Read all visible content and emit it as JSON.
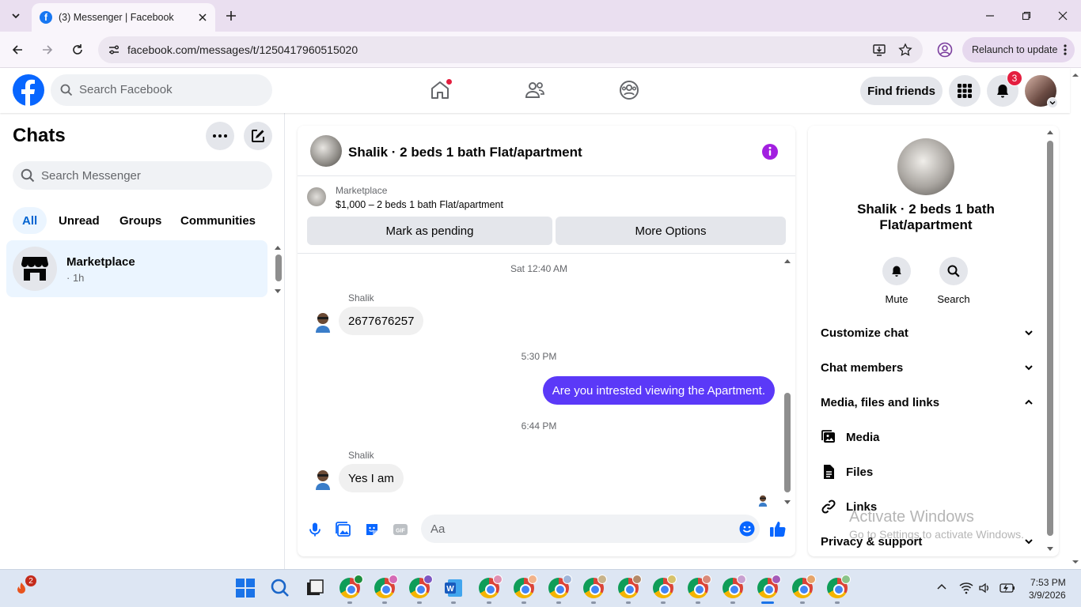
{
  "browser": {
    "tab_title": "(3) Messenger | Facebook",
    "url": "facebook.com/messages/t/1250417960515020",
    "relaunch_label": "Relaunch to update"
  },
  "fb_header": {
    "search_placeholder": "Search Facebook",
    "find_friends_label": "Find friends",
    "notification_count": "3",
    "brand_color": "#0866ff"
  },
  "sidebar": {
    "title": "Chats",
    "search_placeholder": "Search Messenger",
    "filters": [
      "All",
      "Unread",
      "Groups",
      "Communities"
    ],
    "active_filter": "All",
    "chats": [
      {
        "name": "Marketplace",
        "meta": "· 1h"
      }
    ]
  },
  "conversation": {
    "title": "Shalik · 2 beds 1 bath Flat/apartment",
    "marketplace": {
      "label": "Marketplace",
      "listing": "$1,000 – 2 beds 1 bath Flat/apartment",
      "mark_pending_label": "Mark as pending",
      "more_options_label": "More Options"
    },
    "messages": [
      {
        "timestamp": "Sat 12:40 AM"
      },
      {
        "sender": "Shalik",
        "text": "2677676257"
      },
      {
        "timestamp": "5:30 PM"
      },
      {
        "text": "Are you intrested viewing the Apartment."
      },
      {
        "timestamp": "6:44 PM"
      },
      {
        "sender": "Shalik",
        "text": "Yes I am"
      }
    ],
    "composer_placeholder": "Aa",
    "accent_color": "#5b39f8"
  },
  "details": {
    "name": "Shalik · 2 beds 1 bath Flat/apartment",
    "actions": [
      "Mute",
      "Search"
    ],
    "sections": [
      {
        "label": "Customize chat",
        "expanded": false
      },
      {
        "label": "Chat members",
        "expanded": false
      },
      {
        "label": "Media, files and links",
        "expanded": true
      },
      {
        "label": "Privacy & support",
        "expanded": false
      }
    ],
    "media_items": [
      "Media",
      "Files",
      "Links"
    ]
  },
  "watermark": {
    "line1": "Activate Windows",
    "line2": "Go to Settings to activate Windows."
  },
  "taskbar": {
    "weather_badge": "2",
    "time": "7:53 PM",
    "date": "3/9/2026"
  }
}
